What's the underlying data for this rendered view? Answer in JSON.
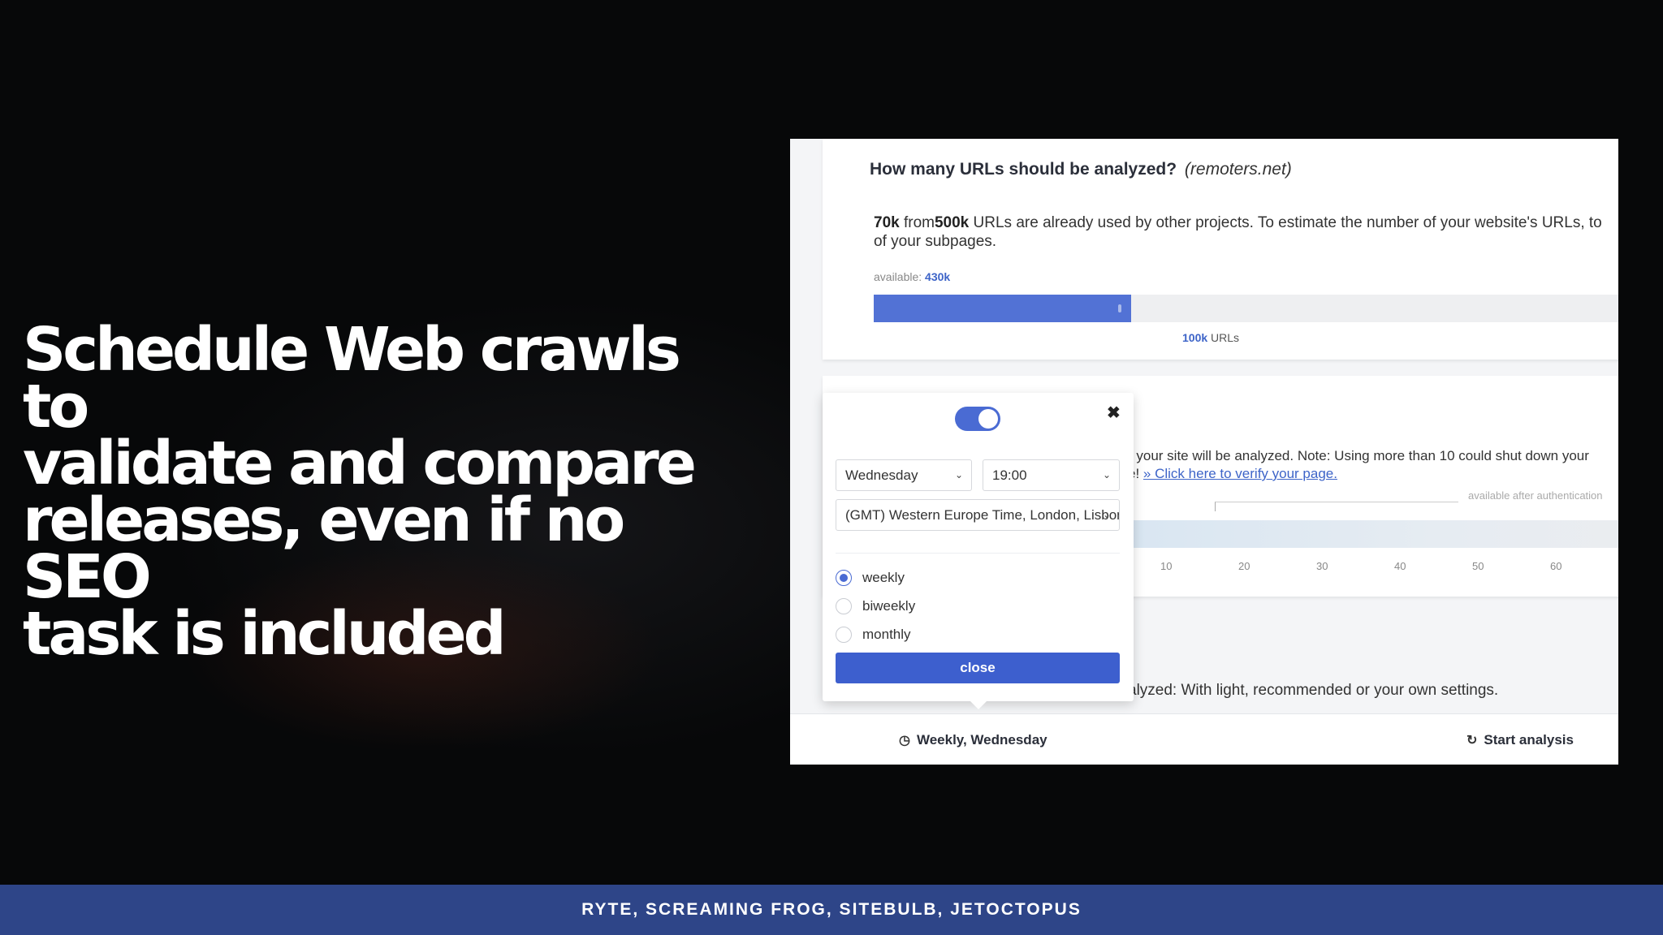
{
  "headline": {
    "line1": "Schedule Web crawls to",
    "line2": "validate and compare",
    "line3": "releases, even if no SEO",
    "line4": "task is included"
  },
  "card1": {
    "title": "How many URLs should be analyzed?",
    "domain": "(remoters.net)",
    "used_amount": "70k",
    "from_word": "from",
    "total_amount": "500k",
    "desc_rest": " URLs are already used by other projects. To estimate the number of your website's URLs, to",
    "desc_line2": "of your subpages.",
    "available_label": "available:",
    "available_value": "430k",
    "slider_value": "100k",
    "slider_unit": "URLs",
    "slider_fraction": 0.33
  },
  "card2": {
    "text_line1": "r your site will be analyzed. Note: Using more than 10 could shut down your",
    "text_line2_prefix": "e!",
    "link": "» Click here to verify your page.",
    "after_auth": "available after authentication",
    "ticks": [
      "10",
      "20",
      "30",
      "40",
      "50",
      "60"
    ]
  },
  "card3": {
    "text": "alyzed: With light, recommended or your own settings."
  },
  "popup": {
    "toggle_on": true,
    "day": "Wednesday",
    "time": "19:00",
    "timezone": "(GMT) Western Europe Time, London, Lisbon",
    "options": [
      "weekly",
      "biweekly",
      "monthly"
    ],
    "selected": "weekly",
    "close_label": "close"
  },
  "footer": {
    "schedule_label": "Weekly, Wednesday",
    "start_label": "Start analysis"
  },
  "band": {
    "text": "RYTE, SCREAMING FROG, SITEBULB, JETOCTOPUS"
  },
  "colors": {
    "accent": "#4a6bd3",
    "band": "#2e4588"
  }
}
